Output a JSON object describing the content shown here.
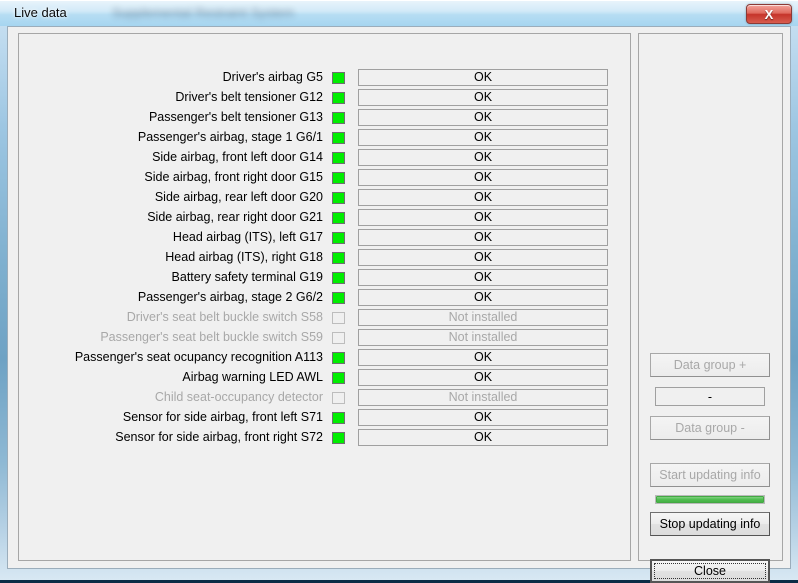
{
  "window": {
    "title": "Live data",
    "title_suffix_redacted": "Supplemental Restraint System",
    "close_label": "X"
  },
  "list": {
    "rows": [
      {
        "label": "Driver's airbag G5",
        "value": "OK",
        "led": "on",
        "enabled": true
      },
      {
        "label": "Driver's belt tensioner G12",
        "value": "OK",
        "led": "on",
        "enabled": true
      },
      {
        "label": "Passenger's belt tensioner G13",
        "value": "OK",
        "led": "on",
        "enabled": true
      },
      {
        "label": "Passenger's airbag, stage 1 G6/1",
        "value": "OK",
        "led": "on",
        "enabled": true
      },
      {
        "label": "Side airbag, front left door G14",
        "value": "OK",
        "led": "on",
        "enabled": true
      },
      {
        "label": "Side airbag, front right door G15",
        "value": "OK",
        "led": "on",
        "enabled": true
      },
      {
        "label": "Side airbag, rear left door G20",
        "value": "OK",
        "led": "on",
        "enabled": true
      },
      {
        "label": "Side airbag, rear right door G21",
        "value": "OK",
        "led": "on",
        "enabled": true
      },
      {
        "label": "Head airbag (ITS), left G17",
        "value": "OK",
        "led": "on",
        "enabled": true
      },
      {
        "label": "Head airbag (ITS), right G18",
        "value": "OK",
        "led": "on",
        "enabled": true
      },
      {
        "label": "Battery safety terminal G19",
        "value": "OK",
        "led": "on",
        "enabled": true
      },
      {
        "label": "Passenger's airbag, stage 2 G6/2",
        "value": "OK",
        "led": "on",
        "enabled": true
      },
      {
        "label": "Driver's seat belt buckle switch S58",
        "value": "Not installed",
        "led": "off",
        "enabled": false
      },
      {
        "label": "Passenger's seat belt buckle switch S59",
        "value": "Not installed",
        "led": "off",
        "enabled": false
      },
      {
        "label": "Passenger's seat ocupancy recognition A113",
        "value": "OK",
        "led": "on",
        "enabled": true
      },
      {
        "label": "Airbag warning LED AWL",
        "value": "OK",
        "led": "on",
        "enabled": true
      },
      {
        "label": "Child seat-occupancy detector",
        "value": "Not installed",
        "led": "off",
        "enabled": false
      },
      {
        "label": "Sensor for side airbag, front left S71",
        "value": "OK",
        "led": "on",
        "enabled": true
      },
      {
        "label": "Sensor for side airbag, front right S72",
        "value": "OK",
        "led": "on",
        "enabled": true
      }
    ]
  },
  "sidebar": {
    "data_group_plus": "Data group +",
    "data_group_value": "-",
    "data_group_minus": "Data group -",
    "start_updating": "Start updating info",
    "stop_updating": "Stop updating info",
    "close": "Close",
    "progress_percent": 100
  },
  "colors": {
    "led_on": "#00ee00",
    "progress_fill": "#4fbd4f",
    "disabled_text": "#a8a8a8",
    "close_button": "#c5342a"
  }
}
